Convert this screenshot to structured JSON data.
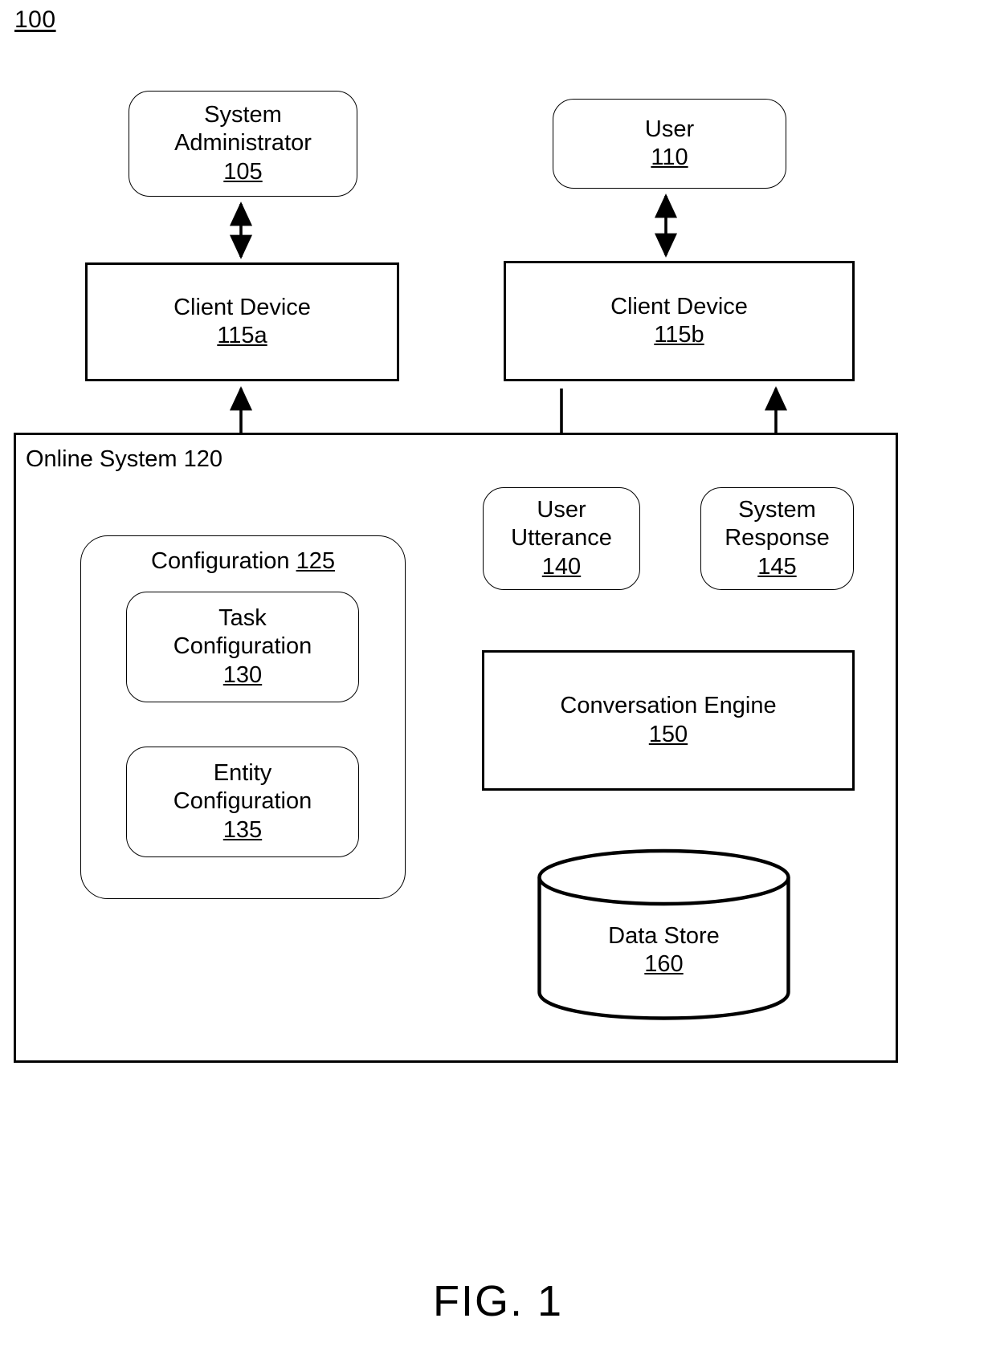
{
  "figure": {
    "number": "100",
    "caption": "FIG. 1"
  },
  "nodes": {
    "system_administrator": {
      "label": "System\nAdministrator",
      "ref": "105"
    },
    "user": {
      "label": "User",
      "ref": "110"
    },
    "client_device_a": {
      "label": "Client Device",
      "ref": "115a"
    },
    "client_device_b": {
      "label": "Client Device",
      "ref": "115b"
    },
    "online_system": {
      "label": "Online System",
      "ref": "120"
    },
    "configuration": {
      "label": "Configuration",
      "ref": "125"
    },
    "task_configuration": {
      "label": "Task\nConfiguration",
      "ref": "130"
    },
    "entity_configuration": {
      "label": "Entity\nConfiguration",
      "ref": "135"
    },
    "user_utterance": {
      "label": "User\nUtterance",
      "ref": "140"
    },
    "system_response": {
      "label": "System\nResponse",
      "ref": "145"
    },
    "conversation_engine": {
      "label": "Conversation Engine",
      "ref": "150"
    },
    "data_store": {
      "label": "Data Store",
      "ref": "160"
    }
  },
  "connectors": [
    {
      "name": "sysadmin-to-client-a",
      "from": "system_administrator",
      "to": "client_device_a",
      "direction": "bidirectional"
    },
    {
      "name": "user-to-client-b",
      "from": "user",
      "to": "client_device_b",
      "direction": "bidirectional"
    },
    {
      "name": "client-a-to-configuration",
      "from": "client_device_a",
      "to": "configuration",
      "direction": "bidirectional"
    },
    {
      "name": "client-b-to-utterance",
      "from": "client_device_b",
      "to": "user_utterance",
      "direction": "unidirectional"
    },
    {
      "name": "response-to-client-b",
      "from": "system_response",
      "to": "client_device_b",
      "direction": "unidirectional"
    },
    {
      "name": "utterance-to-engine",
      "from": "user_utterance",
      "to": "conversation_engine",
      "direction": "unidirectional"
    },
    {
      "name": "engine-to-response",
      "from": "conversation_engine",
      "to": "system_response",
      "direction": "unidirectional"
    },
    {
      "name": "configuration-to-engine",
      "from": "configuration",
      "to": "conversation_engine",
      "direction": "bidirectional"
    },
    {
      "name": "engine-to-data-store",
      "from": "conversation_engine",
      "to": "data_store",
      "direction": "bidirectional"
    }
  ],
  "colors": {
    "stroke": "#000000",
    "background": "#ffffff"
  }
}
